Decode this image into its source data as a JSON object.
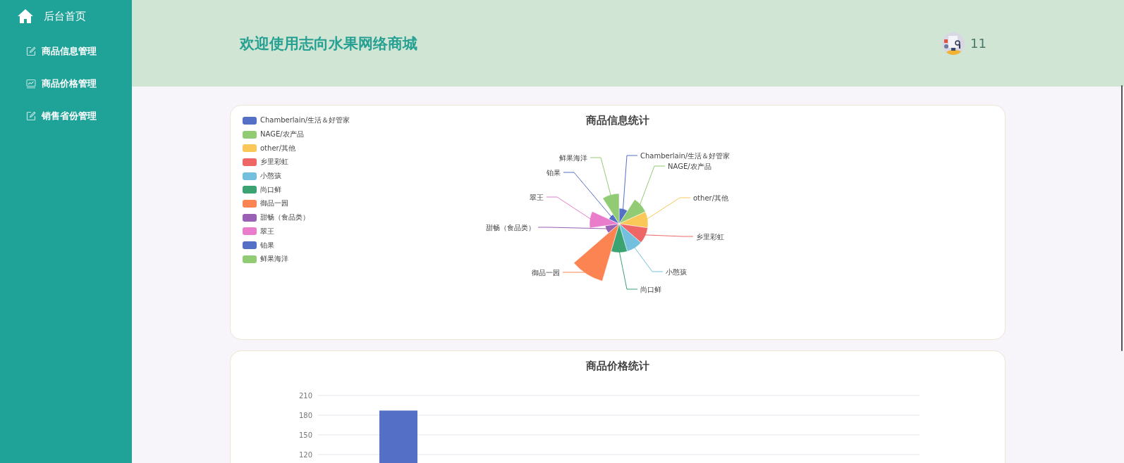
{
  "sidebar": {
    "home": {
      "label": "后台首页"
    },
    "items": [
      {
        "label": "商品信息管理",
        "kind": "edit"
      },
      {
        "label": "商品价格管理",
        "kind": "chart"
      },
      {
        "label": "销售省份管理",
        "kind": "edit"
      }
    ]
  },
  "header": {
    "title": "欢迎使用志向水果网络商城",
    "user": "11"
  },
  "pie_card": {
    "title": "商品信息统计",
    "legend": [
      {
        "name": "Chamberlain/生活＆好管家",
        "color": "#5470c6"
      },
      {
        "name": "NAGE/农产品",
        "color": "#91cc75"
      },
      {
        "name": "other/其他",
        "color": "#fac858"
      },
      {
        "name": "乡里彩虹",
        "color": "#ee6666"
      },
      {
        "name": "小憨孩",
        "color": "#73c0de"
      },
      {
        "name": "尚口鲜",
        "color": "#3ba272"
      },
      {
        "name": "御品一园",
        "color": "#fc8452"
      },
      {
        "name": "甜畅（食品类）",
        "color": "#9a60b4"
      },
      {
        "name": "翠王",
        "color": "#ea7ccc"
      },
      {
        "name": "铂果",
        "color": "#5470c6"
      },
      {
        "name": "鲜果海洋",
        "color": "#91cc75"
      }
    ],
    "slices": [
      {
        "label": "Chamberlain/生活＆好管家"
      },
      {
        "label": "NAGE/农产品"
      },
      {
        "label": "other/其他"
      },
      {
        "label": "乡里彩虹"
      },
      {
        "label": "小憨孩"
      },
      {
        "label": "尚口鲜"
      },
      {
        "label": "御品一园"
      },
      {
        "label": "甜畅（食品类）"
      },
      {
        "label": "翠王"
      },
      {
        "label": "铂果"
      },
      {
        "label": "鲜果海洋"
      }
    ]
  },
  "bar_card": {
    "chart_data": {
      "type": "bar",
      "title": "商品价格统计",
      "values": [
        187
      ],
      "ylim": [
        0,
        210
      ],
      "grid": true,
      "yticks": [
        {
          "value": 120,
          "label": "120"
        },
        {
          "value": 150,
          "label": "150"
        },
        {
          "value": 180,
          "label": "180"
        },
        {
          "value": 210,
          "label": "210"
        }
      ]
    }
  }
}
